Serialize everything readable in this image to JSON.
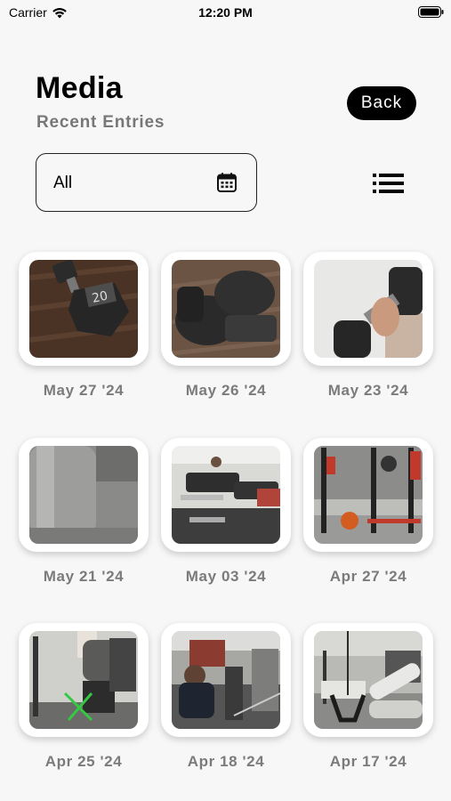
{
  "status_bar": {
    "carrier": "Carrier",
    "time": "12:20 PM",
    "wifi_icon": "wifi-icon",
    "battery_icon": "battery-full-icon"
  },
  "header": {
    "title": "Media",
    "subtitle": "Recent Entries",
    "back_label": "Back"
  },
  "filter": {
    "value": "All",
    "icon": "calendar-icon",
    "view_toggle_icon": "list-view-icon"
  },
  "entries": [
    {
      "date": "May 27 '24",
      "photo": "dumbbell 20 on wood floor"
    },
    {
      "date": "May 26 '24",
      "photo": "boxing gloves on floor"
    },
    {
      "date": "May 23 '24",
      "photo": "hand holding dumbbell"
    },
    {
      "date": "May 21 '24",
      "photo": "metal cylinder closeup"
    },
    {
      "date": "May 03 '24",
      "photo": "gym leg press machines"
    },
    {
      "date": "Apr 27 '24",
      "photo": "squat rack with weights"
    },
    {
      "date": "Apr 25 '24",
      "photo": "person at cable machine"
    },
    {
      "date": "Apr 18 '24",
      "photo": "gym mirror selfie"
    },
    {
      "date": "Apr 17 '24",
      "photo": "cable row handle at feet"
    }
  ],
  "colors": {
    "background": "#f7f7f7",
    "card": "#ffffff",
    "button": "#000000",
    "date_text": "#7b7b7b",
    "subtitle_text": "#777777"
  }
}
